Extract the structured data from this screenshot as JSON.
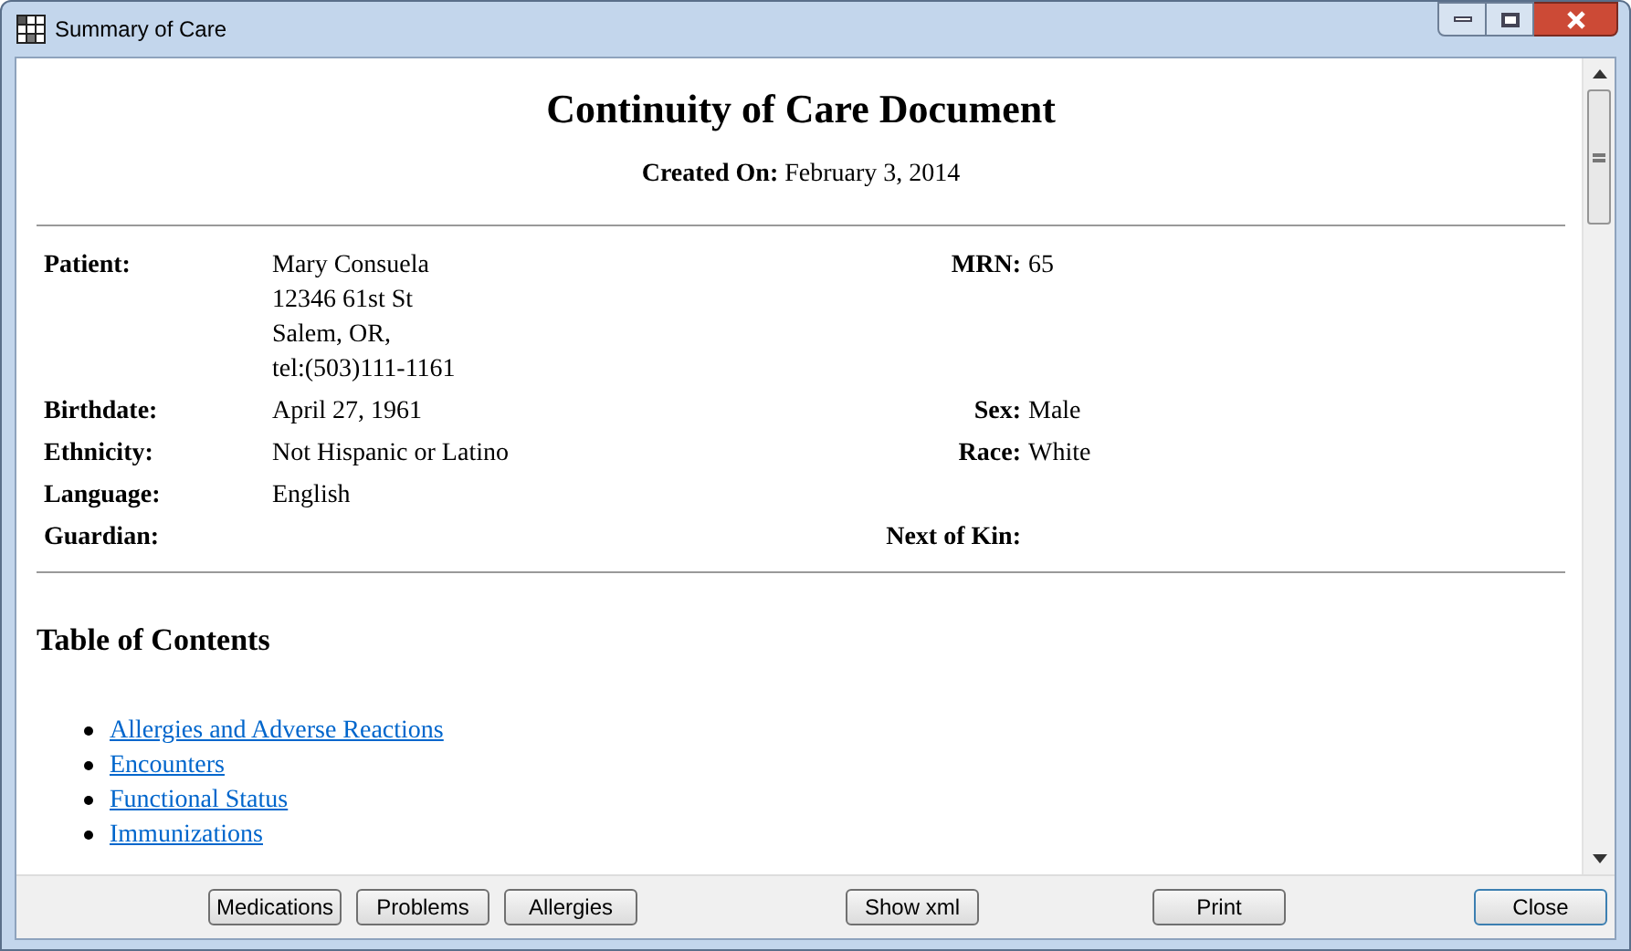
{
  "window": {
    "title": "Summary of Care"
  },
  "document": {
    "title": "Continuity of Care Document",
    "created_label": "Created On:",
    "created_value": "February 3, 2014",
    "patient_rows": [
      {
        "label": "Patient:",
        "value": [
          "Mary Consuela",
          "12346 61st St",
          "Salem, OR,",
          "tel:(503)111-1161"
        ],
        "right_label": "MRN:",
        "right_value": "65"
      },
      {
        "label": "Birthdate:",
        "value": [
          "April 27, 1961"
        ],
        "right_label": "Sex:",
        "right_value": "Male"
      },
      {
        "label": "Ethnicity:",
        "value": [
          "Not Hispanic or Latino"
        ],
        "right_label": "Race:",
        "right_value": "White"
      },
      {
        "label": "Language:",
        "value": [
          "English"
        ]
      },
      {
        "label": "Guardian:",
        "right_label": "Next of Kin:"
      }
    ],
    "toc_title": "Table of Contents",
    "toc": [
      "Allergies and Adverse Reactions",
      "Encounters",
      "Functional Status",
      "Immunizations"
    ]
  },
  "buttons": [
    {
      "label": "Medications",
      "focused": false
    },
    {
      "label": "Problems",
      "focused": false
    },
    {
      "label": "Allergies",
      "focused": false
    },
    {
      "label": "Show xml",
      "focused": false
    },
    {
      "label": "Print",
      "focused": false
    },
    {
      "label": "Close",
      "focused": true
    }
  ]
}
